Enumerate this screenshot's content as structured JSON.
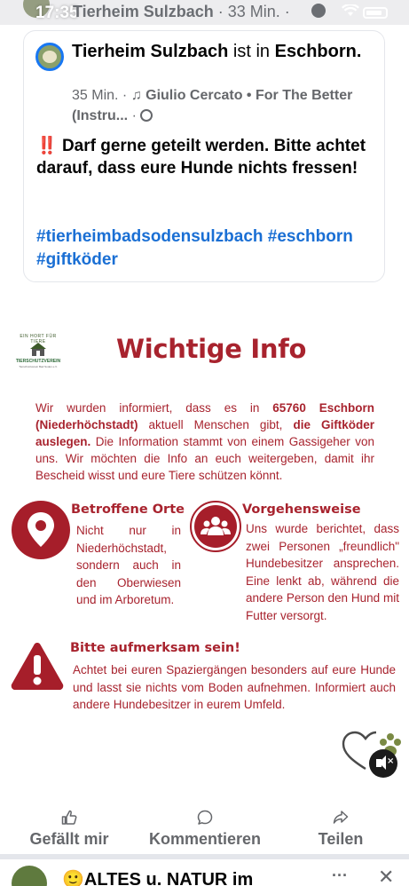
{
  "status_bar": {
    "time": "17:35"
  },
  "top_header": {
    "page_name": "Tierheim Sulzbach",
    "time_ago": "· 33 Min. ·"
  },
  "shared_post": {
    "author": "Tierheim Sulzbach",
    "action": " ist in ",
    "location": "Eschborn.",
    "time": "35 Min. · ",
    "music": "♫ Giulio Cercato • For The Better (Instru... ",
    "dot": "·",
    "body_marks": "‼️",
    "body": " Darf gerne geteilt werden. Bitte achtet darauf, dass eure Hunde nichts fressen!",
    "hashtags": "#tierheimbadsodensulzbach #eschborn #giftköder"
  },
  "flyer": {
    "logo_top": "EIN HORT FÜR TIERE",
    "logo_name": "TIERSCHUTZVEREIN",
    "logo_sub": "Tierschutzverein Bad Soden e.V.",
    "title": "Wichtige Info",
    "intro_1": "Wir wurden informiert, dass es in ",
    "intro_place": "65760 Eschborn (Niederhöchstadt)",
    "intro_2": " aktuell Menschen gibt, ",
    "intro_bold": "die Giftköder auslegen.",
    "intro_3": " Die Information stammt von einem Gassigeher von uns. Wir möchten die Info an euch weitergeben, damit ihr Bescheid wisst und eure Tiere schützen könnt.",
    "section1": {
      "heading": "Betroffene Orte",
      "text": "Nicht nur in Niederhöchstadt, sondern auch in den Oberwiesen und im Arboretum."
    },
    "section2": {
      "heading": "Vorgehensweise",
      "text": "Uns wurde berichtet, dass zwei Personen „freundlich\" Hundebesitzer ansprechen. Eine lenkt ab, während die andere Person den Hund mit Futter versorgt."
    },
    "section3": {
      "heading": "Bitte aufmerksam sein!",
      "text": "Achtet bei euren Spaziergängen besonders auf eure Hunde und lasst sie nichts vom Boden aufnehmen. Informiert auch andere Hundebesitzer in eurem Umfeld."
    },
    "colors": {
      "accent": "#a8232e"
    }
  },
  "actions": {
    "like": "Gefällt mir",
    "comment": "Kommentieren",
    "share": "Teilen"
  },
  "next_post": {
    "title": "🙂ALTES u. NATUR im",
    "more": "···",
    "close": "✕"
  }
}
